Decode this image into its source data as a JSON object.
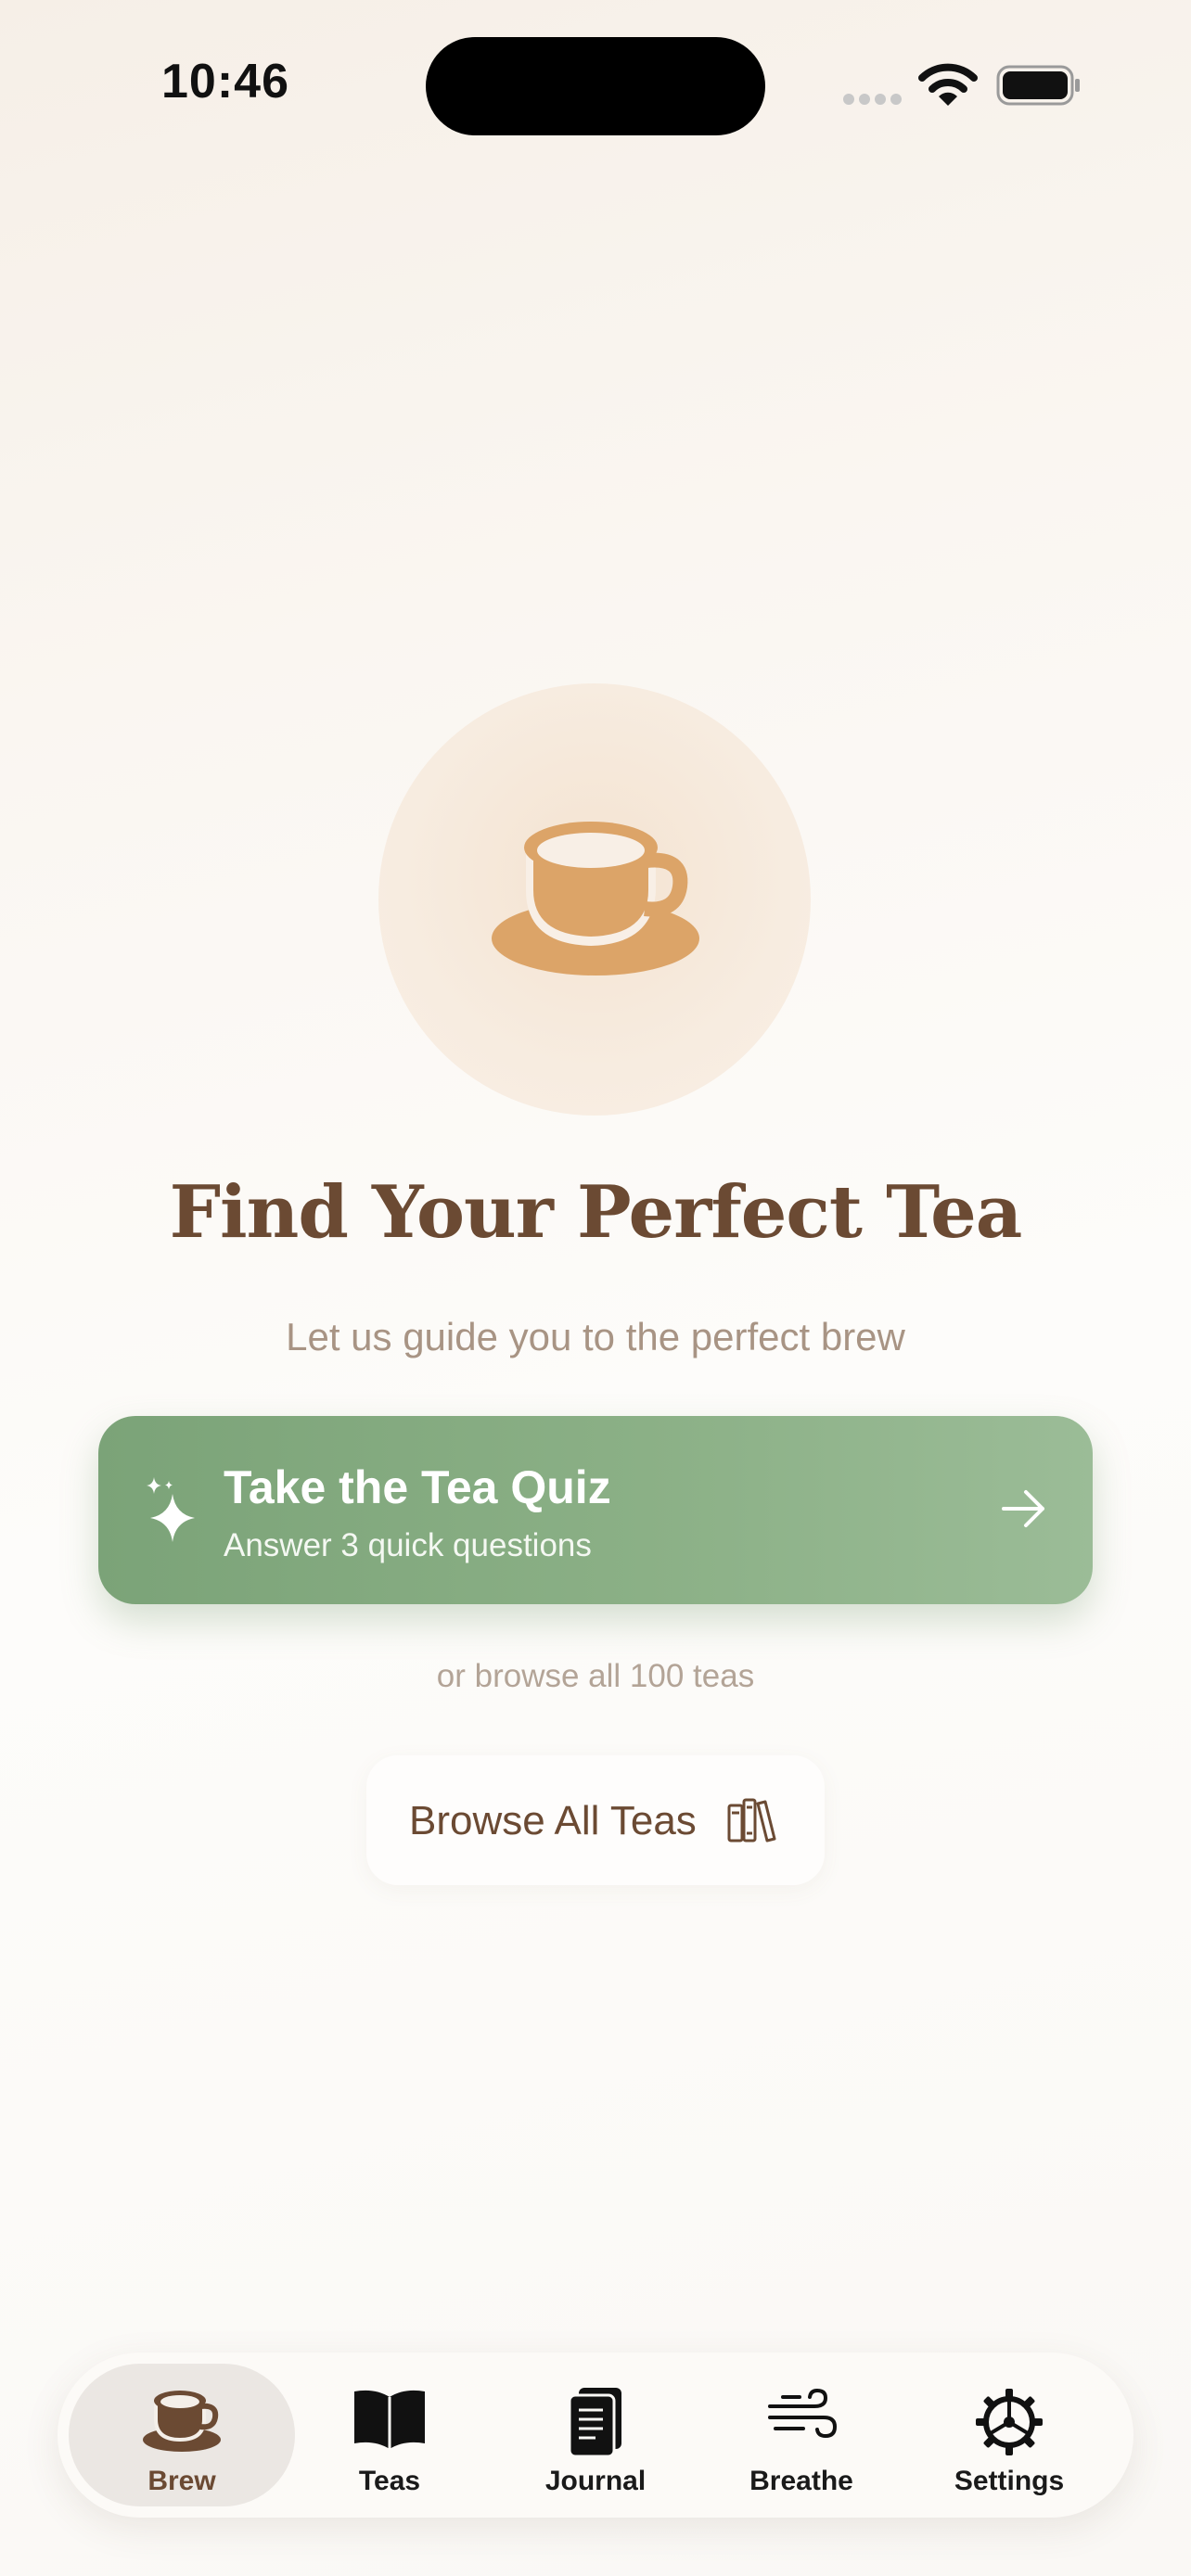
{
  "status_bar": {
    "time": "10:46",
    "icons": [
      "signal-icon",
      "wifi-icon",
      "battery-icon"
    ]
  },
  "hero": {
    "icon": "teacup-icon",
    "title": "Find Your Perfect Tea",
    "subtitle": "Let us guide you to the perfect brew"
  },
  "quiz_button": {
    "icon": "sparkle-icon",
    "title": "Take the Tea Quiz",
    "subtitle": "Answer 3 quick questions",
    "trailing_icon": "arrow-right-icon"
  },
  "browse": {
    "hint": "or browse all 100 teas",
    "button_label": "Browse All Teas",
    "icon": "books-icon"
  },
  "tab_bar": {
    "active": "Brew",
    "tabs": [
      {
        "label": "Brew",
        "icon": "teacup-icon"
      },
      {
        "label": "Teas",
        "icon": "book-icon"
      },
      {
        "label": "Journal",
        "icon": "journal-icon"
      },
      {
        "label": "Breathe",
        "icon": "wind-icon"
      },
      {
        "label": "Settings",
        "icon": "gear-icon"
      }
    ]
  },
  "colors": {
    "accent_brown": "#6b4a33",
    "cup_orange": "#dca468",
    "quiz_green": "#86ab82",
    "muted_text": "#a89484"
  }
}
